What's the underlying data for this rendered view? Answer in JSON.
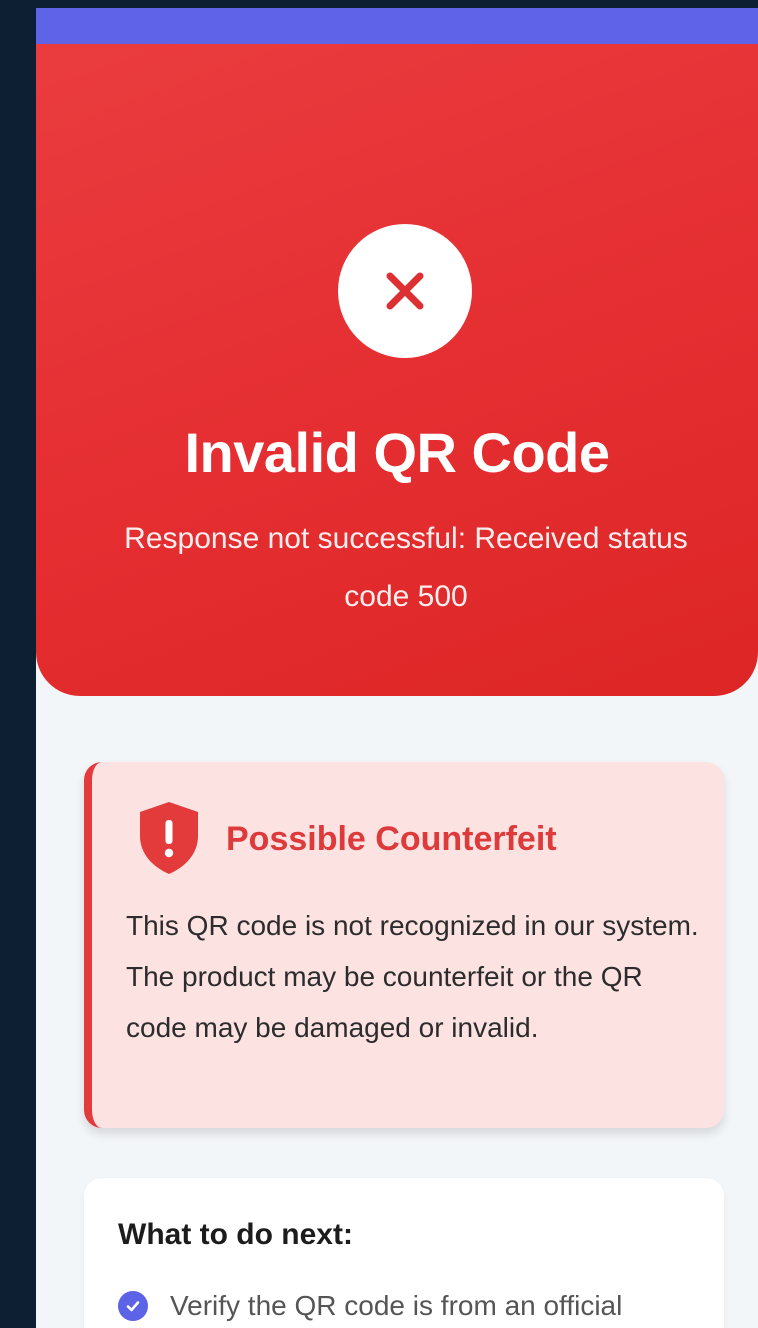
{
  "hero": {
    "icon": "close-x-icon",
    "title": "Invalid QR Code",
    "subtitle": "Response not successful: Received status code 500"
  },
  "warning": {
    "icon": "shield-alert-icon",
    "title": "Possible Counterfeit",
    "body": "This QR code is not recognized in our system. The product may be counterfeit or the QR code may be damaged or invalid."
  },
  "next_steps": {
    "title": "What to do next:",
    "items": [
      {
        "icon": "check-circle-icon",
        "text": "Verify the QR code is from an official"
      }
    ]
  },
  "colors": {
    "accent_bar": "#5f63e8",
    "error_red": "#e5312f",
    "warning_bg": "#fde2e2",
    "warning_text": "#dd3a3c",
    "check_blue": "#5c63e6",
    "outer_background": "#0d1f33"
  }
}
